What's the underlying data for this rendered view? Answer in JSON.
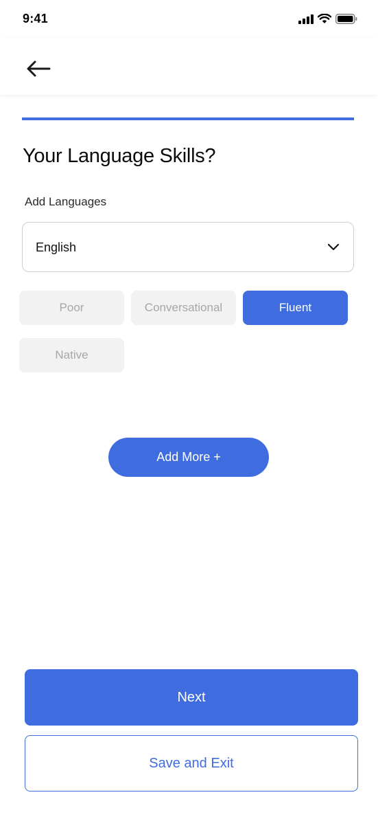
{
  "status_bar": {
    "time": "9:41",
    "icons": [
      "cellular-signal-icon",
      "wifi-icon",
      "battery-icon"
    ]
  },
  "header": {
    "back_icon": "arrow-left-icon"
  },
  "progress": {
    "fraction": 1.0,
    "color": "#3f6ddf"
  },
  "page": {
    "title": "Your Language Skills?",
    "field_label": "Add Languages"
  },
  "language_select": {
    "selected": "English",
    "icon": "chevron-down-icon"
  },
  "proficiency": {
    "options": [
      {
        "label": "Poor",
        "selected": false
      },
      {
        "label": "Conversational",
        "selected": false
      },
      {
        "label": "Fluent",
        "selected": true
      },
      {
        "label": "Native",
        "selected": false
      }
    ]
  },
  "actions": {
    "add_more": "Add More +",
    "next": "Next",
    "save_exit": "Save and Exit"
  },
  "colors": {
    "accent": "#3f6ddf",
    "chip_bg": "#f2f2f2",
    "chip_text": "#a7a7a7"
  }
}
